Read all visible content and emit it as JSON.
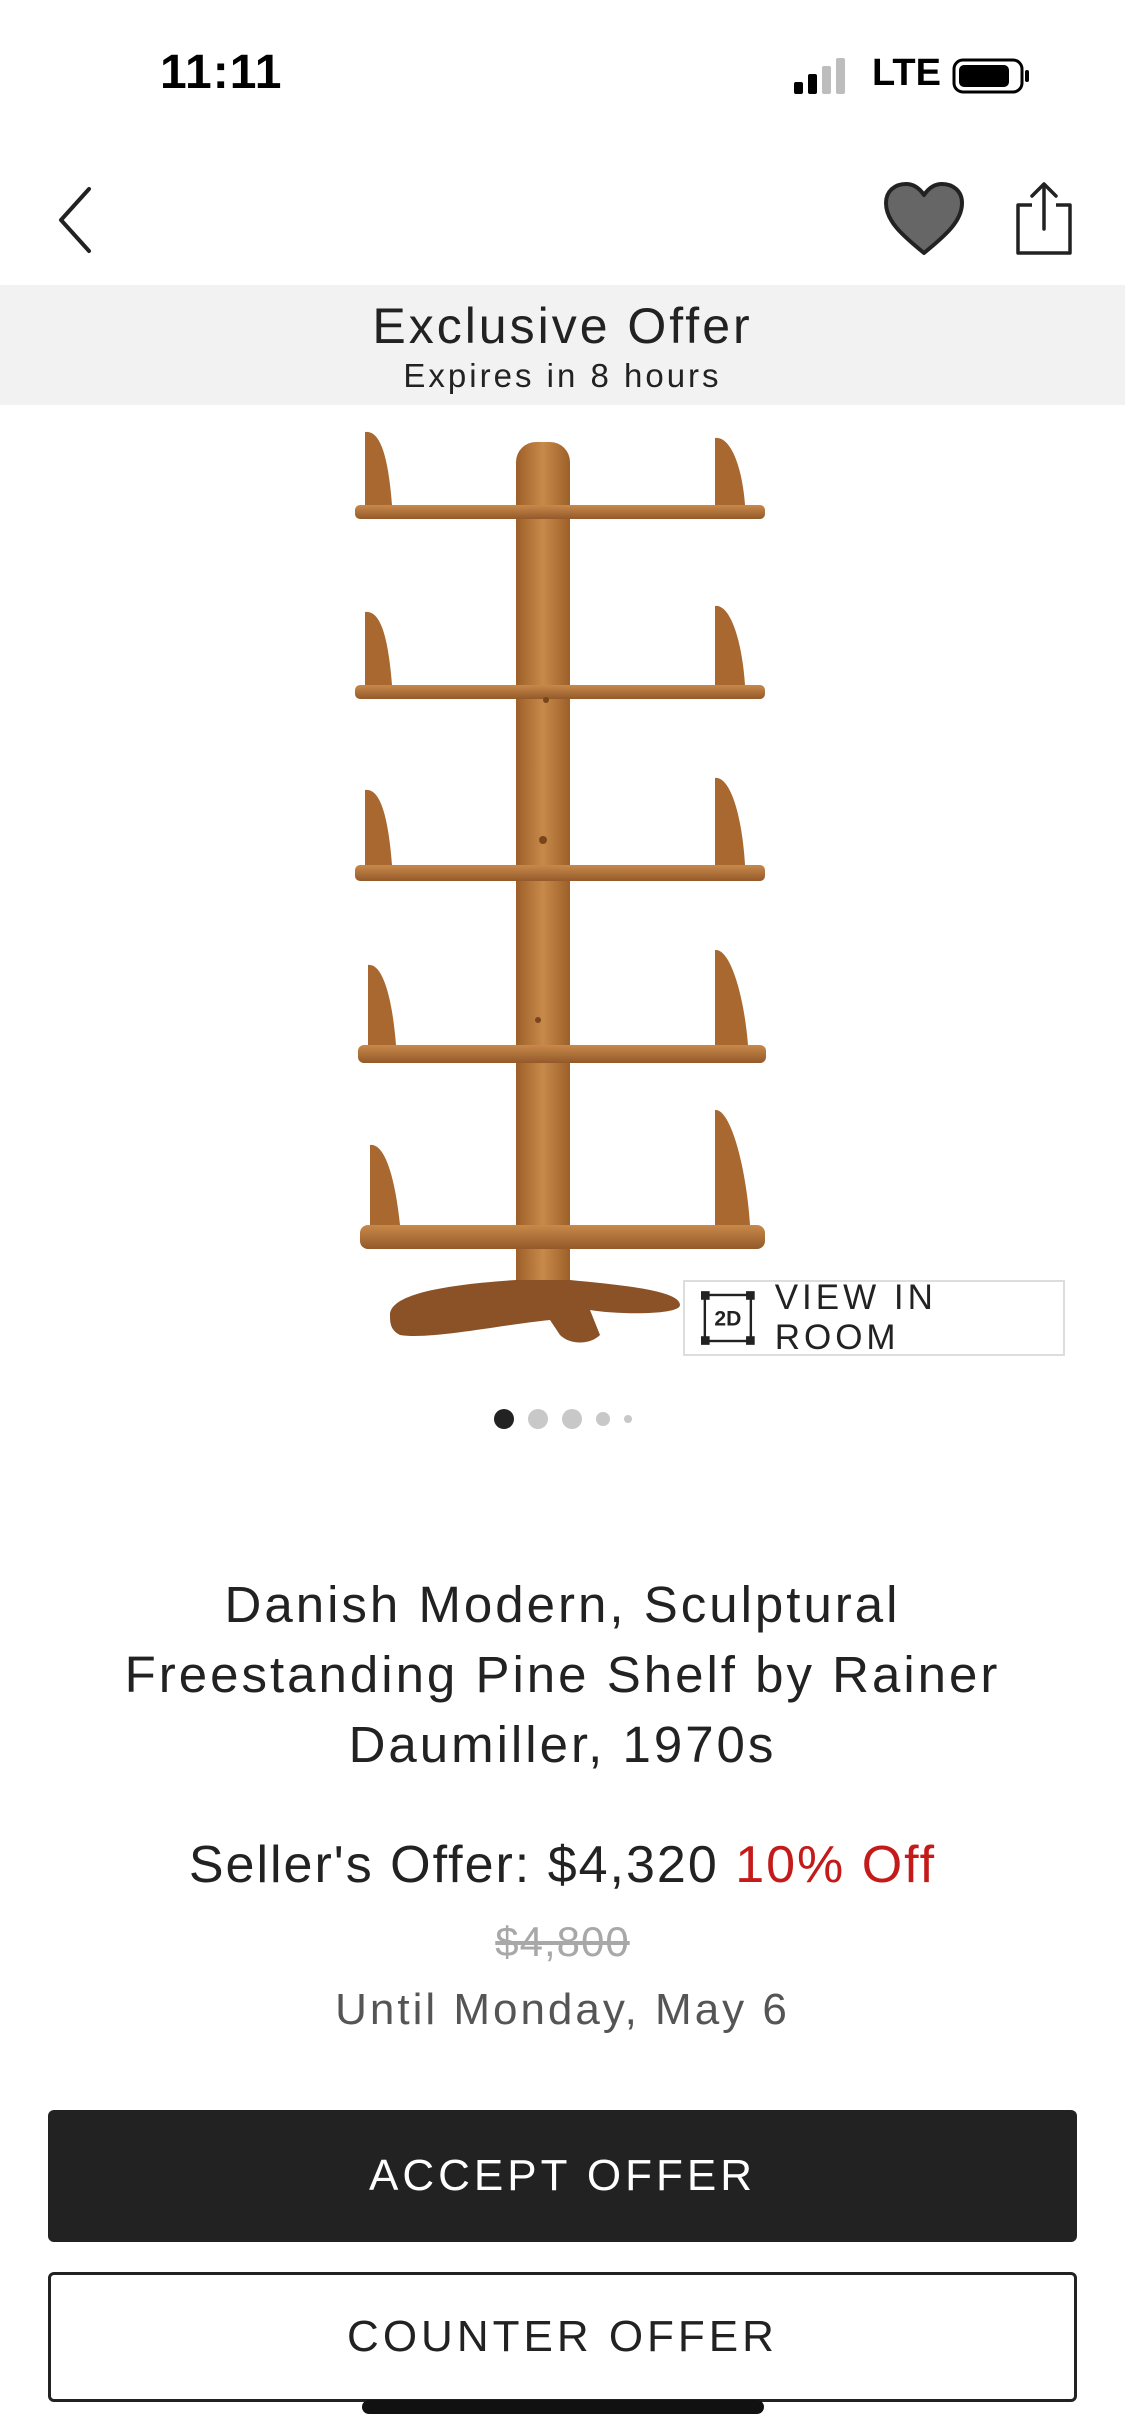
{
  "status_bar": {
    "time": "11:11",
    "network": "LTE"
  },
  "nav": {
    "back_icon": "chevron-left-icon",
    "favorite_icon": "heart-icon",
    "share_icon": "share-icon"
  },
  "offer_banner": {
    "title": "Exclusive Offer",
    "subtitle": "Expires in 8 hours"
  },
  "gallery": {
    "view_in_room_label": "VIEW IN ROOM",
    "view_in_room_badge": "2D",
    "dot_count": 5,
    "active_index": 0
  },
  "product": {
    "title": "Danish Modern, Sculptural Freestanding Pine Shelf by Rainer Daumiller, 1970s",
    "offer_label": "Seller's Offer:",
    "offer_price": "$4,320",
    "discount": "10% Off",
    "original_price": "$4,800",
    "valid_until": "Until Monday, May 6"
  },
  "actions": {
    "accept_label": "ACCEPT OFFER",
    "counter_label": "COUNTER OFFER"
  },
  "colors": {
    "accent_red": "#c41a1a",
    "button_dark": "#222222",
    "banner_bg": "#f2f2f2",
    "wood": "#b87a3e"
  }
}
